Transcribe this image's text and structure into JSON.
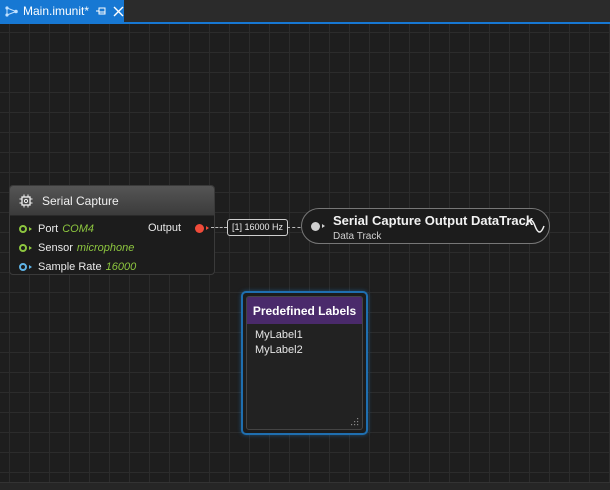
{
  "tab": {
    "title": "Main.imunit*",
    "icon": "node-graph-icon",
    "accent_color": "#1778d3"
  },
  "serial_capture": {
    "title": "Serial Capture",
    "icon": "chip-icon",
    "properties": [
      {
        "name": "Port",
        "value": "COM4",
        "pin_color": "#8dc63f"
      },
      {
        "name": "Sensor",
        "value": "microphone",
        "pin_color": "#8dc63f"
      },
      {
        "name": "Sample Rate",
        "value": "16000",
        "pin_color": "#5fb4e6"
      }
    ],
    "output_label": "Output",
    "output_pin_color": "#f04b3a"
  },
  "connection": {
    "label": "[1] 16000 Hz"
  },
  "data_track": {
    "title": "Serial Capture Output DataTrack",
    "subtitle": "Data Track",
    "icon": "waveform-icon"
  },
  "predefined_labels": {
    "title": "Predefined Labels",
    "header_color": "#4a2a6b",
    "items": [
      "MyLabel1",
      "MyLabel2"
    ]
  }
}
